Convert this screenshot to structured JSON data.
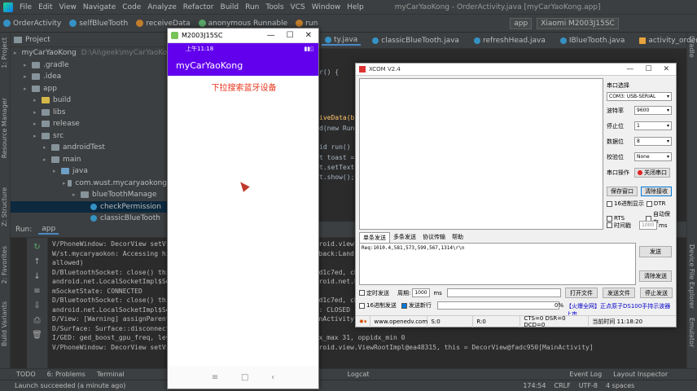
{
  "ide": {
    "menu": [
      "File",
      "Edit",
      "View",
      "Navigate",
      "Code",
      "Analyze",
      "Refactor",
      "Build",
      "Run",
      "Tools",
      "VCS",
      "Window",
      "Help"
    ],
    "window_title": "myCarYaoKong - OrderActivity.java [myCarYaoKong.app]",
    "breadcrumbs": [
      "OrderActivity",
      "selfBlueTooth",
      "receiveData",
      "anonymous Runnable",
      "run"
    ],
    "run_config": "app",
    "device": "Xiaomi M2003J15SC",
    "editor_tabs": [
      "ty.java",
      "classicBlueTooth.java",
      "refreshHead.java",
      "IBlueTooth.java",
      "activity_order.xml"
    ],
    "project_label": "Project",
    "tree": [
      {
        "label": "myCarYaoKong",
        "hint": "D:\\Ai\\geek\\myCarYaoKong",
        "indent": 0,
        "icon": "folder"
      },
      {
        "label": ".gradle",
        "indent": 1,
        "icon": "folder"
      },
      {
        "label": ".idea",
        "indent": 1,
        "icon": "folder"
      },
      {
        "label": "app",
        "indent": 1,
        "icon": "folder"
      },
      {
        "label": "build",
        "indent": 2,
        "icon": "folder-y"
      },
      {
        "label": "libs",
        "indent": 2,
        "icon": "folder"
      },
      {
        "label": "release",
        "indent": 2,
        "icon": "folder"
      },
      {
        "label": "src",
        "indent": 2,
        "icon": "folder"
      },
      {
        "label": "androidTest",
        "indent": 3,
        "icon": "folder"
      },
      {
        "label": "main",
        "indent": 3,
        "icon": "folder"
      },
      {
        "label": "java",
        "indent": 4,
        "icon": "folder-b"
      },
      {
        "label": "com.wust.mycaryaokong",
        "indent": 5,
        "icon": "folder"
      },
      {
        "label": "blueToothManage",
        "indent": 6,
        "icon": "folder"
      },
      {
        "label": "checkPermission",
        "indent": 7,
        "icon": "java"
      },
      {
        "label": "classicBlueTooth",
        "indent": 7,
        "icon": "java"
      }
    ],
    "code_lines": [
      "r() {",
      "iveData(b",
      "d(new Run",
      "id run() {",
      "t toast =",
      "t.setText",
      "t.show();"
    ],
    "run_tab": "Run:",
    "run_app": "app",
    "log": [
      {
        "text": "V/PhoneWindow: DecorView setVisibility: visibility = 4, Parent = android.view.ViewRootImpl@ea48315",
        "err": false
      },
      {
        "text": "W/st.mycaryaokon: Accessing hidden field Landroid/os/Message;->mCallback:Landroid/os/Message$Callback; (greylist, reflection,",
        "err": false
      },
      {
        "text": "    allowed)",
        "err": false
      },
      {
        "text": "D/BluetoothSocket: close() this: android.bluetooth.BluetoothSocket@7d1c7ed, channel: 1, mSocketIS: android.net.",
        "err": false
      },
      {
        "text": "    android.net.LocalSocketImpl$SocketOutputStream@2a6ed8b, mSocket: android.net.LocalSocket@5b2e9c4 impl:",
        "err": false
      },
      {
        "text": "    mSocketState: CONNECTED",
        "err": false
      },
      {
        "text": "D/BluetoothSocket: close() this: android.bluetooth.BluetoothSocket@7d1c7ed, channel: 1, mSocketIS: android.net.",
        "err": false
      },
      {
        "text": "    android.net.LocalSocketImpl$SocketOutputStream@2a6ed8b, mSocketState: CLOSED",
        "err": false
      },
      {
        "text": "D/View: [Warning] assignParent to null: this = DecorView@fadc950[MainActivity]",
        "err": false
      },
      {
        "text": "D/Surface: Surface::disconnect(this=0x7c2b3a4000,api=1)",
        "err": false
      },
      {
        "text": "I/GED: ged_boost_gpu_freq, level 100, eOrigin 2, final_idx 31, oppidx_max 31, oppidx_min 0",
        "err": false
      },
      {
        "text": "V/PhoneWindow: DecorView setVisibility: visibility = 0, Parent = android.view.ViewRootImpl@ea48315, this = DecorView@fadc950[MainActivity]",
        "err": false
      }
    ],
    "bottom_tools": [
      "TODO",
      "6: Problems",
      "Terminal",
      "Logcat"
    ],
    "bottom_right_tools": [
      "Event Log",
      "Layout Inspector"
    ],
    "status_left": "Launch succeeded (a minute ago)",
    "status_right": [
      "174:54",
      "CRLF",
      "UTF-8",
      "4 spaces"
    ],
    "left_strip": [
      "1: Project",
      "Resource Manager",
      "Z: Structure",
      "2: Favorites",
      "Build Variants"
    ],
    "right_strip": [
      "Gradle",
      "Device File Explorer",
      "Emulator"
    ]
  },
  "emulator": {
    "title": "M2003J15SC",
    "time": "上午11:18",
    "app_title": "myCarYaoKong",
    "pull_text": "下拉搜索蓝牙设备",
    "accent": "#6200ee"
  },
  "xcom": {
    "title": "XCOM V2.4",
    "port_label": "串口选择",
    "port_value": "COM3: USB-SERIAL",
    "baud_label": "波特率",
    "baud_value": "9600",
    "stop_label": "停止位",
    "stop_value": "1",
    "data_label": "数据位",
    "data_value": "8",
    "parity_label": "校验位",
    "parity_value": "None",
    "op_label": "串口操作",
    "op_button": "关闭串口",
    "save_button": "保存窗口",
    "clear_button": "清除接收",
    "hex_display": "16进制显示",
    "dtr": "DTR",
    "rts": "RTS",
    "autosave": "自动保存",
    "timestamp": "时间戳",
    "timestamp_ms": "1000",
    "tabs": [
      "单条发送",
      "多条发送",
      "协议传输",
      "帮助"
    ],
    "send_text": "Req:1010.4,581,573,599,567,1314\\r\\n",
    "send_button": "发送",
    "clear_send_button": "清除发送",
    "timed_send": "定时发送",
    "period_label": "周期:",
    "period_value": "1000",
    "ms": "ms",
    "open_file": "打开文件",
    "send_file": "发送文件",
    "stop_send": "停止发送",
    "hex_send": "16进制发送",
    "newline": "发送新行",
    "progress": "0%",
    "promo": "【火爆全网】正点原子DS100手持示波器上市",
    "website": "www.openedv.com",
    "s_count": "S:0",
    "r_count": "R:0",
    "signals": "CTS=0 DSR=0 DCD=0",
    "time": "当前时间 11:18:20"
  }
}
